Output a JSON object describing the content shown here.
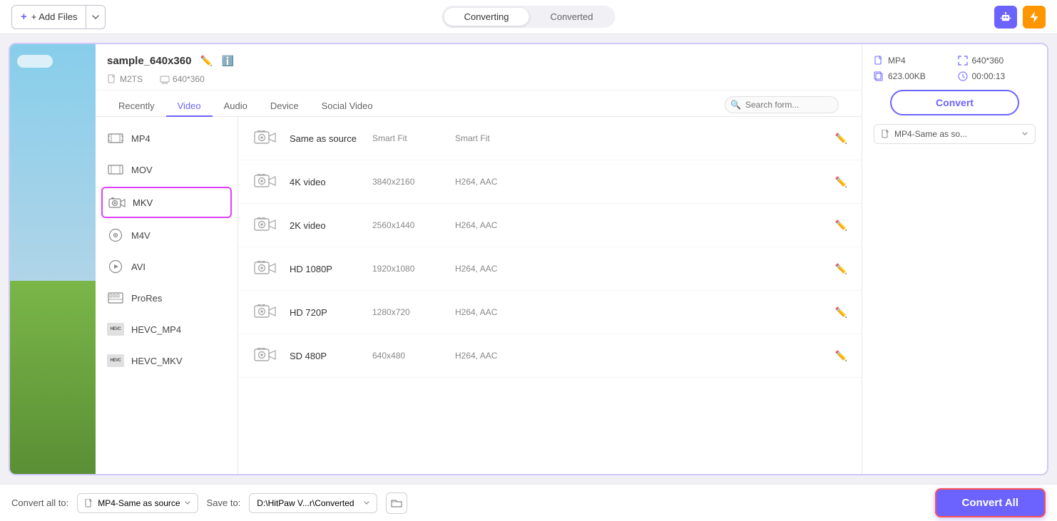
{
  "topbar": {
    "add_files_label": "+ Add Files",
    "tab_converting": "Converting",
    "tab_converted": "Converted",
    "tab_converting_active": true
  },
  "file": {
    "name": "sample_640x360",
    "source_format": "M2TS",
    "source_res": "640*360",
    "output_format": "MP4",
    "output_res": "640*360",
    "file_size": "623.00KB",
    "duration": "00:00:13",
    "selected_preset": "MP4-Same as so..."
  },
  "format_tabs": [
    {
      "label": "Recently",
      "active": false
    },
    {
      "label": "Video",
      "active": true
    },
    {
      "label": "Audio",
      "active": false
    },
    {
      "label": "Device",
      "active": false
    },
    {
      "label": "Social Video",
      "active": false
    }
  ],
  "search": {
    "placeholder": "Search form..."
  },
  "format_types": [
    {
      "id": "mp4",
      "label": "MP4",
      "selected": false,
      "icon_type": "film"
    },
    {
      "id": "mov",
      "label": "MOV",
      "selected": false,
      "icon_type": "film-small"
    },
    {
      "id": "mkv",
      "label": "MKV",
      "selected": true,
      "icon_type": "camera"
    },
    {
      "id": "m4v",
      "label": "M4V",
      "selected": false,
      "icon_type": "disc"
    },
    {
      "id": "avi",
      "label": "AVI",
      "selected": false,
      "icon_type": "play-circle"
    },
    {
      "id": "prores",
      "label": "ProRes",
      "selected": false,
      "icon_type": "film-strip"
    },
    {
      "id": "hevc_mp4",
      "label": "HEVC_MP4",
      "selected": false,
      "icon_type": "hevc"
    },
    {
      "id": "hevc_mkv",
      "label": "HEVC_MKV",
      "selected": false,
      "icon_type": "hevc"
    }
  ],
  "format_options": [
    {
      "name": "Same as source",
      "resolution": "Smart Fit",
      "codec": "Smart Fit"
    },
    {
      "name": "4K video",
      "resolution": "3840x2160",
      "codec": "H264, AAC"
    },
    {
      "name": "2K video",
      "resolution": "2560x1440",
      "codec": "H264, AAC"
    },
    {
      "name": "HD 1080P",
      "resolution": "1920x1080",
      "codec": "H264, AAC"
    },
    {
      "name": "HD 720P",
      "resolution": "1280x720",
      "codec": "H264, AAC"
    },
    {
      "name": "SD 480P",
      "resolution": "640x480",
      "codec": "H264, AAC"
    }
  ],
  "convert_button": {
    "label": "Convert"
  },
  "bottom_bar": {
    "convert_all_to_label": "Convert all to:",
    "convert_all_format": "MP4-Same as source",
    "save_to_label": "Save to:",
    "save_to_path": "D:\\HitPaw V...r\\Converted",
    "convert_all_btn": "Convert All"
  }
}
